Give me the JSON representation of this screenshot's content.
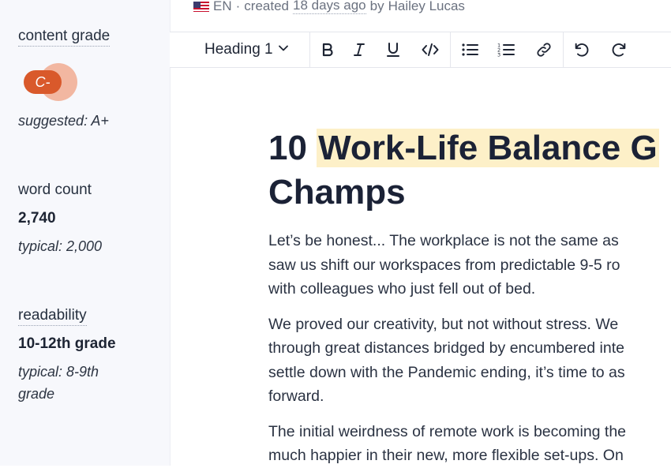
{
  "meta": {
    "language": "EN",
    "separator": "·",
    "created_prefix": "created",
    "created_ago": "18 days ago",
    "by_prefix": "by",
    "author": "Hailey Lucas"
  },
  "sidebar": {
    "content_grade": {
      "label": "content grade",
      "grade": "C-",
      "suggested": "suggested: A+"
    },
    "word_count": {
      "label": "word count",
      "value": "2,740",
      "typical": "typical: 2,000"
    },
    "readability": {
      "label": "readability",
      "value": "10-12th grade",
      "typical_line1": "typical: 8-9th",
      "typical_line2": "grade"
    }
  },
  "toolbar": {
    "heading_label": "Heading 1",
    "buttons": [
      "bold-icon",
      "italic-icon",
      "underline-icon",
      "code-icon",
      "bullet-list-icon",
      "numbered-list-icon",
      "link-icon",
      "undo-icon",
      "redo-icon"
    ]
  },
  "document": {
    "title_start": "10 ",
    "title_highlight": "Work-Life Balance G",
    "title_line2": "Champs",
    "paragraphs": [
      [
        "Let’s be honest... The workplace is not the same as",
        "saw us shift our workspaces from predictable 9-5 ro",
        "with colleagues who just fell out of bed."
      ],
      [
        "We proved our creativity, but not without stress. We",
        "through great distances bridged by encumbered inte",
        "settle down with the Pandemic ending, it’s time to as",
        "forward."
      ],
      [
        "The initial weirdness of remote work is becoming the",
        "much happier in their new, more flexible set-ups. On"
      ]
    ]
  },
  "colors": {
    "grade_pill": "#d9592b",
    "grade_ring": "#f2b7a1",
    "highlight": "#fdf0c8",
    "sidebar_bg": "#f7f8fc"
  }
}
